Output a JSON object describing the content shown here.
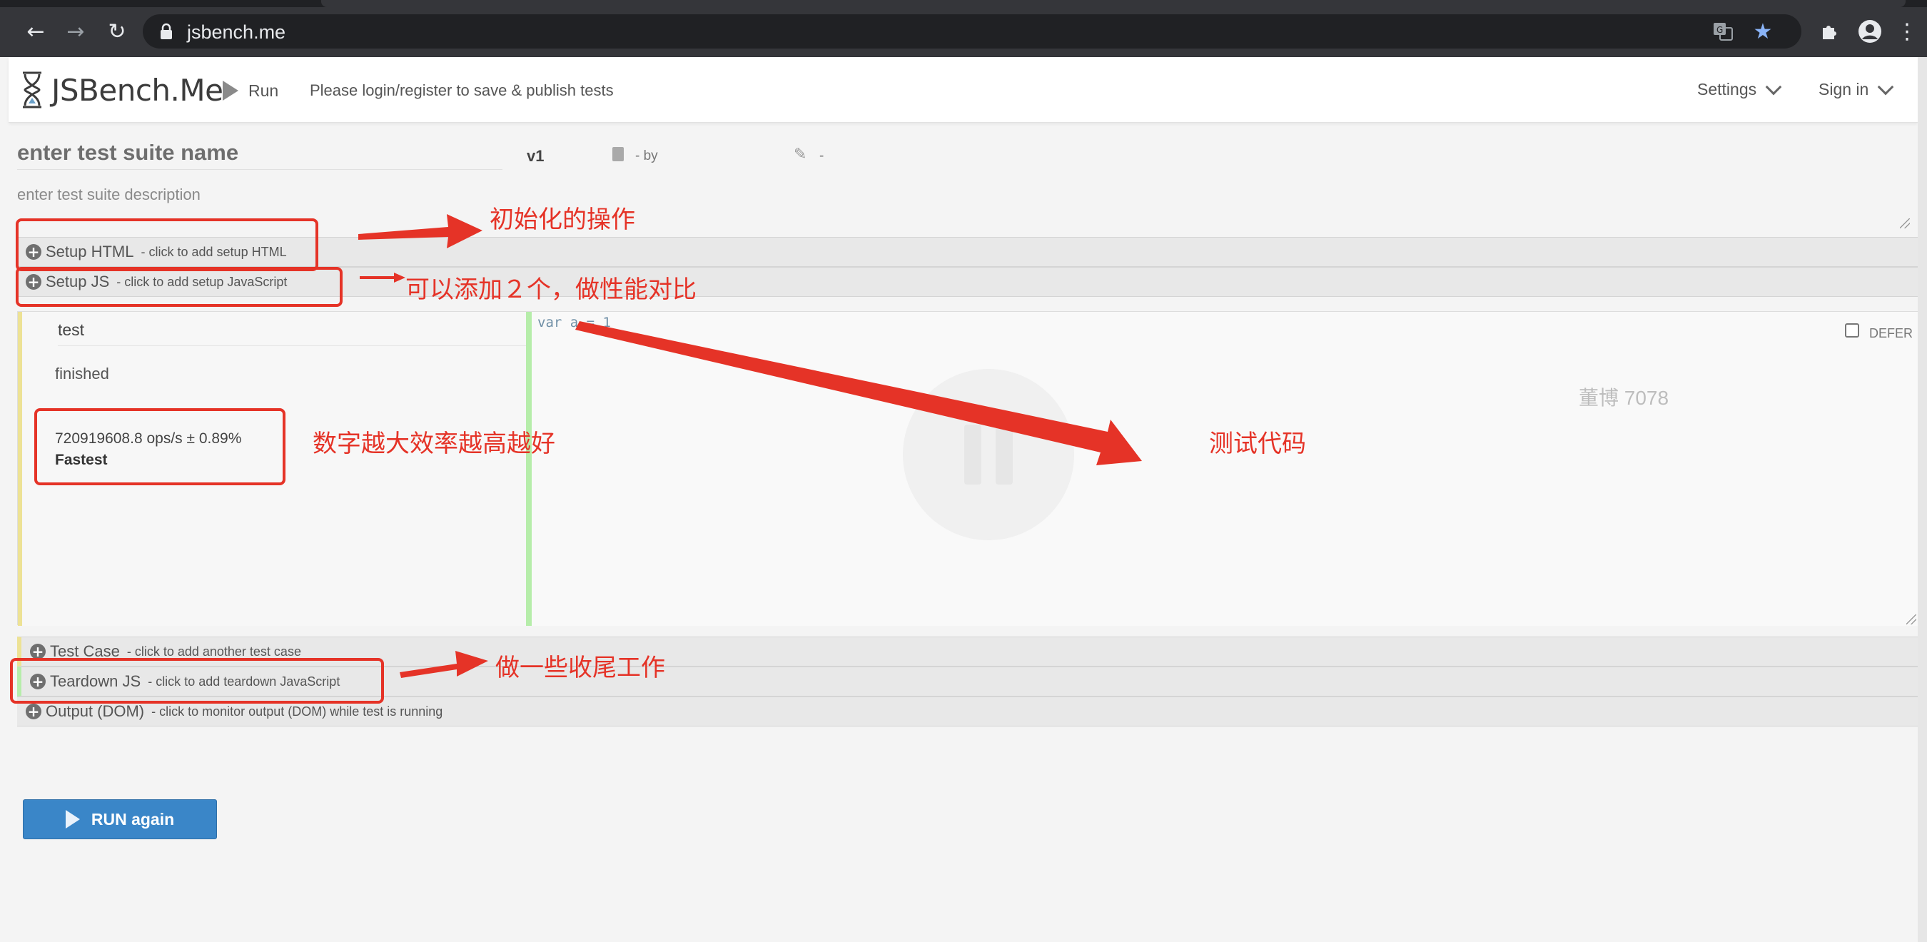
{
  "browser": {
    "url": "jsbench.me",
    "back_icon": "arrow-left-icon",
    "forward_icon": "arrow-right-icon",
    "reload_icon": "reload-icon"
  },
  "header": {
    "brand": "JSBench.Me",
    "run_label": "Run",
    "login_message": "Please login/register to save & publish tests",
    "settings_label": "Settings",
    "signin_label": "Sign in"
  },
  "suite": {
    "name_placeholder": "enter test suite name",
    "version": "v1",
    "by_text": "- by",
    "edit_text": "-",
    "description_placeholder": "enter test suite description"
  },
  "sections": {
    "setup_html": {
      "title": "Setup HTML",
      "hint": "click to add setup HTML"
    },
    "setup_js": {
      "title": "Setup JS",
      "hint": "click to add setup JavaScript"
    },
    "test_case": {
      "title": "Test Case",
      "hint": "click to add another test case"
    },
    "teardown_js": {
      "title": "Teardown JS",
      "hint": "click to add teardown JavaScript"
    },
    "output_dom": {
      "title": "Output (DOM)",
      "hint": "click to monitor output (DOM) while test is running"
    }
  },
  "test_case": {
    "name": "test",
    "status": "finished",
    "ops": "720919608.8 ops/s ± 0.89%",
    "rank": "Fastest",
    "code": "var a = 1",
    "defer_label": "DEFER"
  },
  "watermark": "董博 7078",
  "run_again_label": "RUN again",
  "annotations": {
    "setup_html_note": "初始化的操作",
    "setup_js_note": "可以添加２个，做性能对比",
    "result_note": "数字越大效率越高越好",
    "code_note": "测试代码",
    "teardown_note": "做一些收尾工作"
  },
  "colors": {
    "annotation": "#e53327",
    "run_button": "#3a86c8",
    "code_gutter": "#b6edaa",
    "case_bar": "#ede295"
  }
}
